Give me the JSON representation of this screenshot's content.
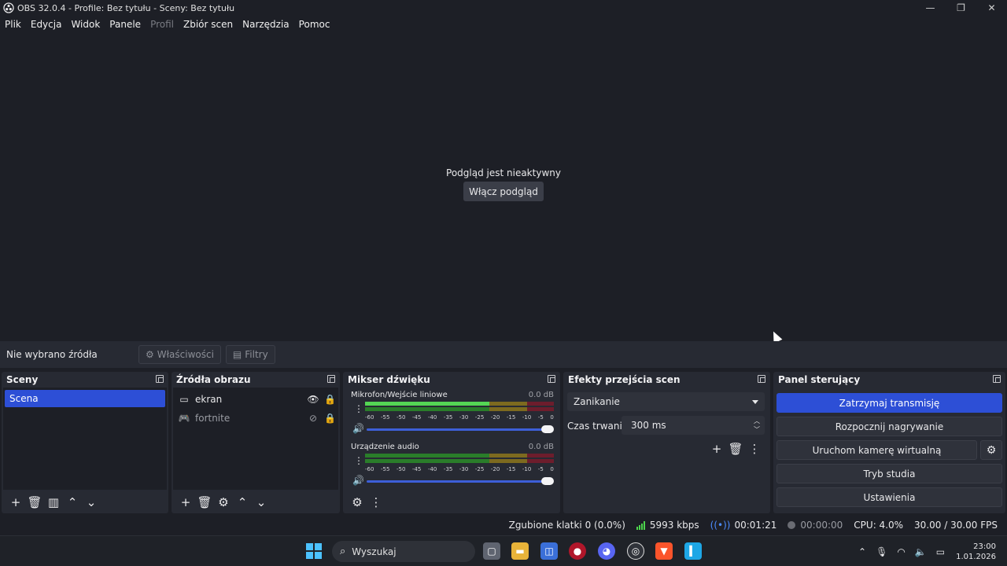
{
  "window": {
    "title": "OBS 32.0.4 - Profile: Bez tytułu - Sceny: Bez tytułu",
    "minimize": "—",
    "restore": "❐",
    "close": "✕"
  },
  "menu": {
    "items": [
      "Plik",
      "Edycja",
      "Widok",
      "Panele",
      "Profil",
      "Zbiór scen",
      "Narzędzia",
      "Pomoc"
    ],
    "disabled_index": 4
  },
  "preview": {
    "status_text": "Podgląd jest nieaktywny",
    "enable_button": "Włącz podgląd"
  },
  "context_bar": {
    "no_source": "Nie wybrano źródła",
    "properties": "Właściwości",
    "filters": "Filtry"
  },
  "scenes": {
    "title": "Sceny",
    "items": [
      "Scena"
    ]
  },
  "sources": {
    "title": "Źródła obrazu",
    "items": [
      {
        "name": "ekran",
        "icon": "monitor-icon",
        "visible": true
      },
      {
        "name": "fortnite",
        "icon": "gamepad-icon",
        "visible": false
      }
    ]
  },
  "mixer": {
    "title": "Mikser dźwięku",
    "channels": [
      {
        "name": "Mikrofon/Wejście liniowe",
        "db": "0.0 dB",
        "active": true
      },
      {
        "name": "Urządzenie audio",
        "db": "0.0 dB",
        "active": false
      }
    ],
    "scale": [
      "-60",
      "-55",
      "-50",
      "-45",
      "-40",
      "-35",
      "-30",
      "-25",
      "-20",
      "-15",
      "-10",
      "-5",
      "0"
    ]
  },
  "transitions": {
    "title": "Efekty przejścia scen",
    "selected": "Zanikanie",
    "duration_label": "Czas trwania",
    "duration_value": "300 ms"
  },
  "controls": {
    "title": "Panel sterujący",
    "stop_stream": "Zatrzymaj transmisję",
    "start_recording": "Rozpocznij nagrywanie",
    "start_virtual_cam": "Uruchom kamerę wirtualną",
    "studio_mode": "Tryb studia",
    "settings": "Ustawienia"
  },
  "status": {
    "dropped_frames": "Zgubione klatki 0 (0.0%)",
    "bitrate": "5993 kbps",
    "stream_time": "00:01:21",
    "record_time": "00:00:00",
    "cpu": "CPU: 4.0%",
    "fps": "30.00 / 30.00 FPS",
    "colors": {
      "bitrate_bars": "#4cd44c",
      "stream_icon": "#4c8cff"
    }
  },
  "taskbar": {
    "search_placeholder": "Wyszukaj",
    "time": "23:00",
    "date": "1.01.2026"
  },
  "colors": {
    "accent": "#2d4fd6",
    "panel": "#272a33",
    "background": "#1d1f26"
  }
}
